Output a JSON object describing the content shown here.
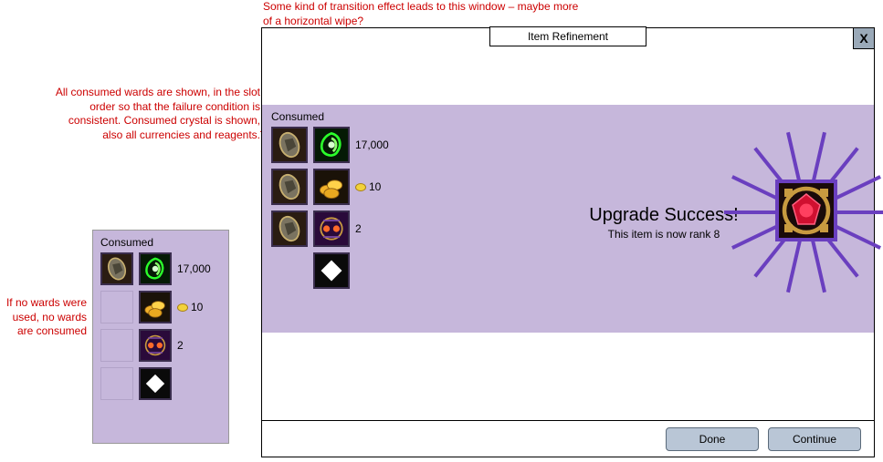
{
  "annotations": {
    "top": "Some kind of transition effect leads to this window – maybe more of a horizontal wipe?",
    "left1": "All consumed wards are shown, in the slot order so that the failure condition is consistent. Consumed crystal is shown, also all currencies and reagents.",
    "left2": "If no wards were used, no wards are consumed"
  },
  "window": {
    "title": "Item Refinement",
    "close": "X",
    "consumed_label": "Consumed",
    "upgrade_title": "Upgrade Success!",
    "upgrade_sub": "This item is now rank 8",
    "done": "Done",
    "continue": "Continue"
  },
  "main_consumed": {
    "rows": [
      {
        "ward": "ward-stone",
        "item": "green-swirl",
        "qty": "17,000",
        "gold": false
      },
      {
        "ward": "ward-stone",
        "item": "gold-coins",
        "qty": "10",
        "gold": true
      },
      {
        "ward": "ward-stone",
        "item": "purple-rune",
        "qty": "2",
        "gold": false
      },
      {
        "ward": null,
        "item": "white-diamond",
        "qty": "",
        "gold": false
      }
    ]
  },
  "side_panel": {
    "label": "Consumed",
    "rows": [
      {
        "ward": "ward-stone",
        "item": "green-swirl",
        "qty": "17,000",
        "gold": false
      },
      {
        "ward": null,
        "item": "gold-coins",
        "qty": "10",
        "gold": true
      },
      {
        "ward": null,
        "item": "purple-rune",
        "qty": "2",
        "gold": false
      },
      {
        "ward": null,
        "item": "white-diamond",
        "qty": "",
        "gold": false
      }
    ]
  },
  "result_item": "red-gem"
}
